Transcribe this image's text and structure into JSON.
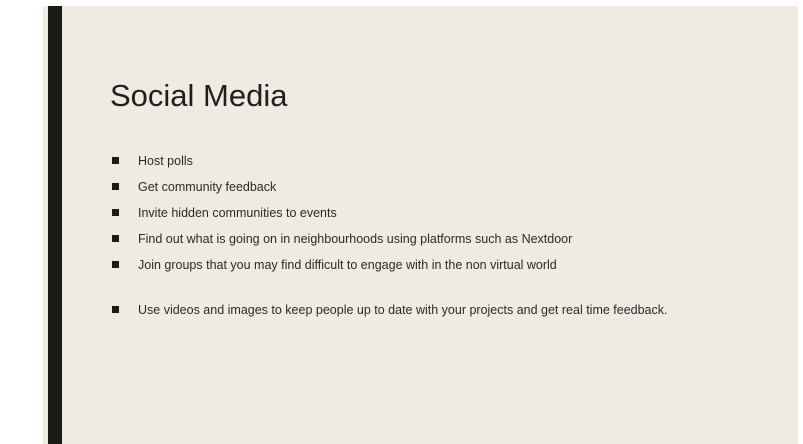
{
  "slide": {
    "title": "Social Media",
    "bullets": [
      "Host polls",
      "Get community feedback",
      "Invite hidden communities to events",
      "Find out what is going on in neighbourhoods using platforms such as Nextdoor",
      "Join groups that you may find difficult to engage with in the non virtual world",
      "Use videos and images to keep people up to date with your projects and get real time feedback."
    ]
  },
  "colors": {
    "background": "#efebe3",
    "accent_bar": "#1c1b17",
    "text": "#2a2a2a"
  }
}
